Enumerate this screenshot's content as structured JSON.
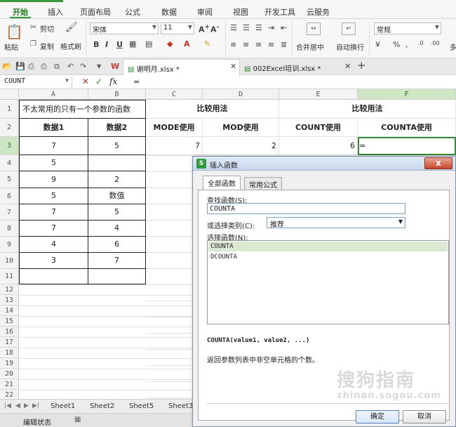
{
  "menu": {
    "tabs": [
      "开始",
      "插入",
      "页面布局",
      "公式",
      "数据",
      "审阅",
      "视图",
      "开发工具",
      "云服务"
    ]
  },
  "ribbon": {
    "paste": "粘贴",
    "cut": "剪切",
    "copy": "复制",
    "format_painter": "格式刷",
    "font_name": "宋体",
    "font_size": "11",
    "merge_center": "合并居中",
    "wrap_text": "自动换行",
    "number_format": "常规",
    "percent": "%",
    "overflow": "多"
  },
  "doc_tabs": {
    "file1": "谢明月.xlsx *",
    "file2": "002Excel培训.xlsx *"
  },
  "formula_bar": {
    "name_box": "COUNT",
    "fx": "fx",
    "content": "="
  },
  "columns": [
    "A",
    "B",
    "C",
    "D",
    "E",
    "F"
  ],
  "rows": [
    "1",
    "2",
    "3",
    "4",
    "5",
    "6",
    "7",
    "8",
    "9",
    "10",
    "11",
    "12",
    "13",
    "14",
    "15",
    "16",
    "17",
    "18",
    "19",
    "20",
    "21",
    "22"
  ],
  "cells": {
    "a1": "不太常用的只有一个参数的函数",
    "cd1": "比较用法",
    "ef1": "比较用法",
    "a2": "数据1",
    "b2": "数据2",
    "c2": "MODE使用",
    "d2": "MOD使用",
    "e2": "COUNT使用",
    "f2": "COUNTA使用",
    "a3": "7",
    "b3": "5",
    "c3": "7",
    "d3": "2",
    "e3": "6",
    "f3": "=",
    "a4": "5",
    "b4": "",
    "a5": "9",
    "b5": "2",
    "a6": "5",
    "b6": "数值",
    "a7": "7",
    "b7": "5",
    "a8": "7",
    "b8": "4",
    "a9": "4",
    "b9": "6",
    "a10": "3",
    "b10": "7"
  },
  "sheets": [
    "Sheet1",
    "Sheet2",
    "Sheet5",
    "Sheet3"
  ],
  "status": {
    "mode": "编辑状态"
  },
  "dialog": {
    "title": "插入函数",
    "close": "x",
    "tabs": [
      "全部函数",
      "常用公式"
    ],
    "search_label": "查找函数(S):",
    "search_value": "COUNTA",
    "category_label": "或选择类别(C):",
    "category_value": "推荐",
    "select_label": "选择函数(N):",
    "functions": [
      "COUNTA",
      "DCOUNTA"
    ],
    "syntax": "COUNTA(value1, value2, ...)",
    "description": "返回参数列表中非空单元格的个数。",
    "ok": "确定",
    "cancel": "取消"
  },
  "watermark": {
    "text": "搜狗指南",
    "url": "zhinan.sogou.com"
  }
}
